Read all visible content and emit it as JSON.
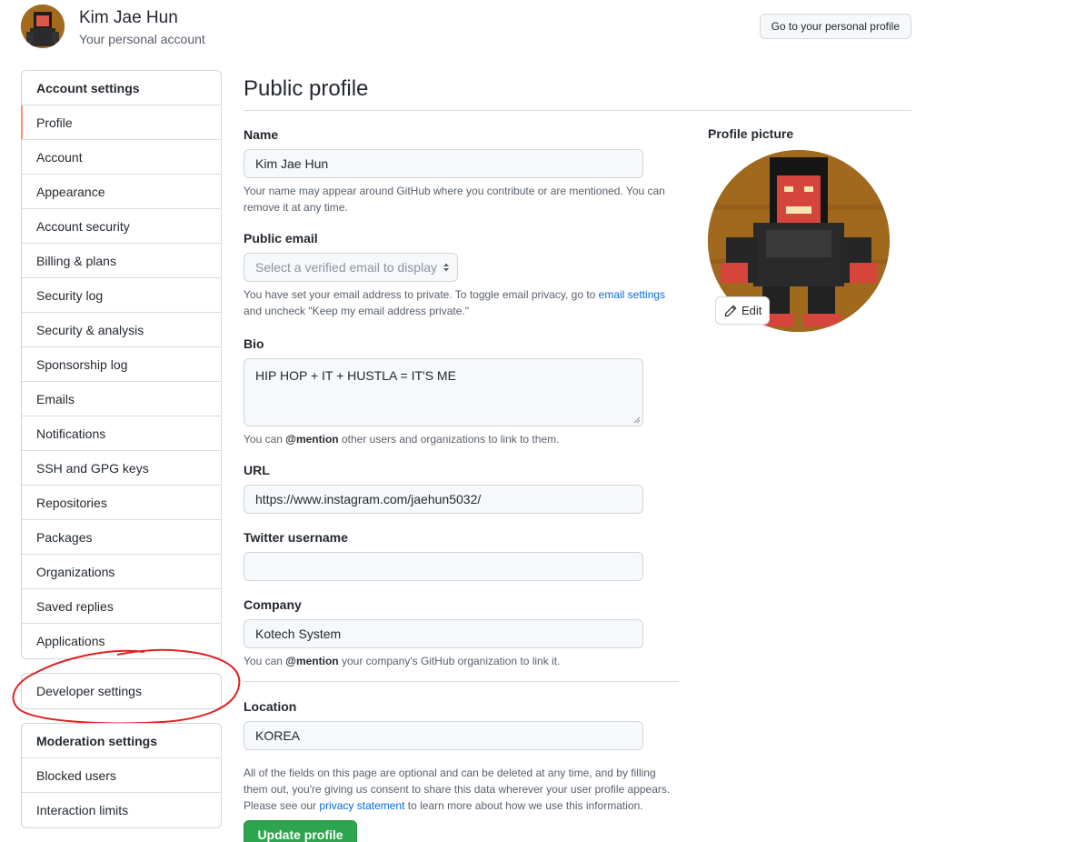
{
  "header": {
    "user_name": "Kim Jae Hun",
    "user_sub": "Your personal account",
    "personal_profile_button": "Go to your personal profile"
  },
  "sidebar": {
    "account_heading": "Account settings",
    "items": [
      {
        "label": "Profile",
        "active": true
      },
      {
        "label": "Account"
      },
      {
        "label": "Appearance"
      },
      {
        "label": "Account security"
      },
      {
        "label": "Billing & plans"
      },
      {
        "label": "Security log"
      },
      {
        "label": "Security & analysis"
      },
      {
        "label": "Sponsorship log"
      },
      {
        "label": "Emails"
      },
      {
        "label": "Notifications"
      },
      {
        "label": "SSH and GPG keys"
      },
      {
        "label": "Repositories"
      },
      {
        "label": "Packages"
      },
      {
        "label": "Organizations"
      },
      {
        "label": "Saved replies"
      },
      {
        "label": "Applications"
      }
    ],
    "developer_settings": "Developer settings",
    "moderation_heading": "Moderation settings",
    "moderation_items": [
      {
        "label": "Blocked users"
      },
      {
        "label": "Interaction limits"
      }
    ]
  },
  "main": {
    "title": "Public profile",
    "name": {
      "label": "Name",
      "value": "Kim Jae Hun",
      "note": "Your name may appear around GitHub where you contribute or are mentioned. You can remove it at any time."
    },
    "public_email": {
      "label": "Public email",
      "placeholder": "Select a verified email to display",
      "note_before": "You have set your email address to private. To toggle email privacy, go to ",
      "note_link": "email settings",
      "note_after": " and uncheck \"Keep my email address private.\""
    },
    "bio": {
      "label": "Bio",
      "value": "HIP HOP + IT + HUSTLA = IT'S ME",
      "note_before": "You can ",
      "note_mention": "@mention",
      "note_after": " other users and organizations to link to them."
    },
    "url": {
      "label": "URL",
      "value": "https://www.instagram.com/jaehun5032/"
    },
    "twitter": {
      "label": "Twitter username",
      "value": ""
    },
    "company": {
      "label": "Company",
      "value": "Kotech System",
      "note_before": "You can ",
      "note_mention": "@mention",
      "note_after": " your company's GitHub organization to link it."
    },
    "location": {
      "label": "Location",
      "value": "KOREA"
    },
    "footer_note_before": "All of the fields on this page are optional and can be deleted at any time, and by filling them out, you're giving us consent to share this data wherever your user profile appears. Please see our ",
    "footer_note_link": "privacy statement",
    "footer_note_after": " to learn more about how we use this information.",
    "update_button": "Update profile",
    "profile_picture_label": "Profile picture",
    "edit_button": "Edit"
  },
  "colors": {
    "link": "#0969da",
    "primary_button": "#2da44e",
    "active_indicator": "#fd8c73",
    "annotation": "#e02020"
  }
}
